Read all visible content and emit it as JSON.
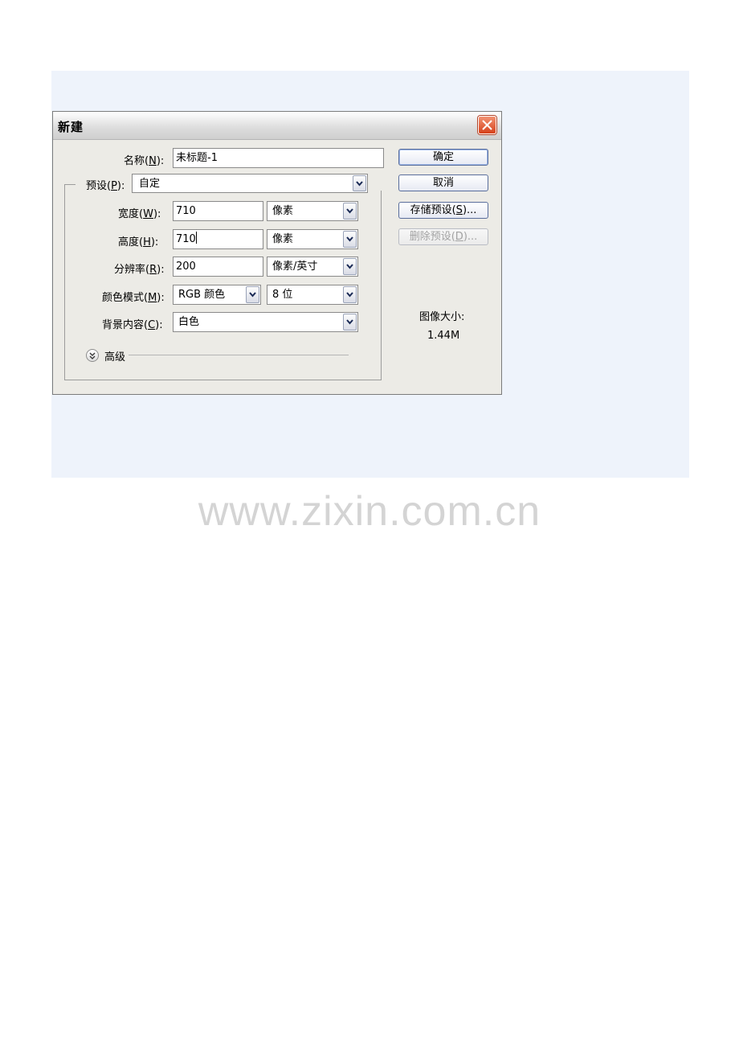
{
  "dialog": {
    "title": "新建",
    "name": {
      "label_pre": "名称(",
      "mnemonic": "N",
      "label_post": "):",
      "value": "未标题-1"
    },
    "preset": {
      "label_pre": "预设(",
      "mnemonic": "P",
      "label_post": "):",
      "value": "自定"
    },
    "width": {
      "label_pre": "宽度(",
      "mnemonic": "W",
      "label_post": "):",
      "value": "710",
      "unit": "像素"
    },
    "height": {
      "label_pre": "高度(",
      "mnemonic": "H",
      "label_post": "):",
      "value": "710",
      "unit": "像素"
    },
    "resolution": {
      "label_pre": "分辨率(",
      "mnemonic": "R",
      "label_post": "):",
      "value": "200",
      "unit": "像素/英寸"
    },
    "color_mode": {
      "label_pre": "颜色模式(",
      "mnemonic": "M",
      "label_post": "):",
      "value": "RGB 颜色",
      "depth": "8 位"
    },
    "background": {
      "label_pre": "背景内容(",
      "mnemonic": "C",
      "label_post": "):",
      "value": "白色"
    },
    "advanced_label": "高级",
    "buttons": {
      "ok": "确定",
      "cancel": "取消",
      "save_pre": "存储预设(",
      "save_mn": "S",
      "save_post": ")...",
      "delete_pre": "删除预设(",
      "delete_mn": "D",
      "delete_post": ")..."
    },
    "image_size_label": "图像大小:",
    "image_size_value": "1.44M"
  },
  "watermark": "www.zixin.com.cn",
  "colors": {
    "panel_bg": "#eef3fb",
    "close_red": "#d6411c",
    "dialog_bg": "#ecebe6"
  }
}
